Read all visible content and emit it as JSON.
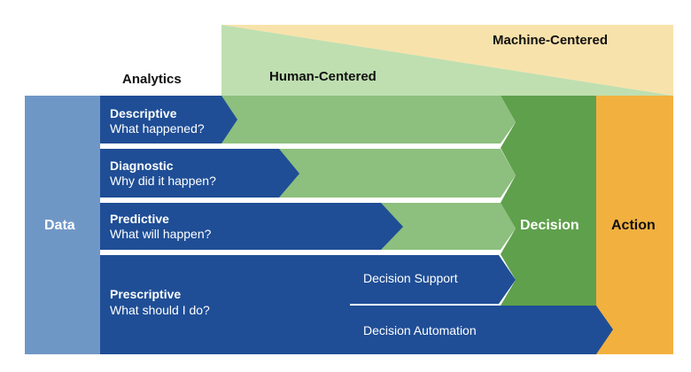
{
  "headers": {
    "machine_centered": "Machine-Centered",
    "human_centered": "Human-Centered",
    "analytics": "Analytics"
  },
  "stages": {
    "data": "Data",
    "decision": "Decision",
    "action": "Action"
  },
  "analytics_rows": [
    {
      "title": "Descriptive",
      "question": "What happened?"
    },
    {
      "title": "Diagnostic",
      "question": "Why did it happen?"
    },
    {
      "title": "Predictive",
      "question": "What will happen?"
    },
    {
      "title": "Prescriptive",
      "question": "What should I do?"
    }
  ],
  "prescriptive_outputs": {
    "support": "Decision Support",
    "automation": "Decision Automation"
  },
  "colors": {
    "data_block": "#6f97c6",
    "row_blue": "#1f4e96",
    "light_green": "#8dbf7e",
    "decision_green": "#5fa04c",
    "action_orange": "#f2b13f",
    "human_wedge": "#bfdfb0",
    "machine_wedge": "#f8e2ab"
  }
}
